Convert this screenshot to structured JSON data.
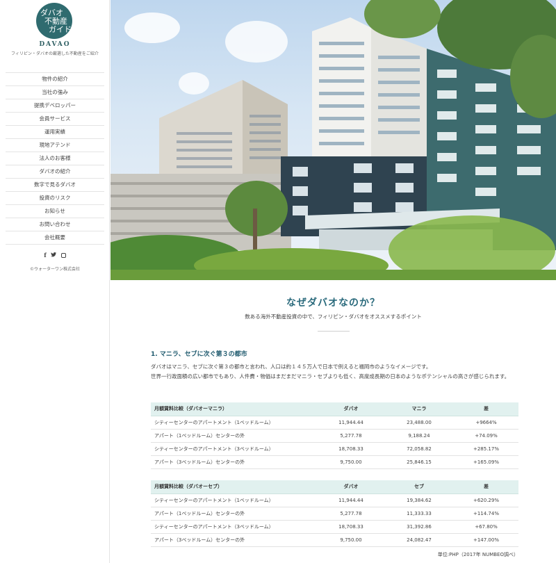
{
  "logo": {
    "mark_line1": "ダバオ",
    "mark_line2": "不動産",
    "mark_line3": "ガイド",
    "wordmark": "DAVAO",
    "tagline": "フィリピン・ダバオの厳選した不動産をご紹介"
  },
  "nav": {
    "items": [
      {
        "label": "物件の紹介"
      },
      {
        "label": "当社の強み"
      },
      {
        "label": "提携デベロッパー"
      },
      {
        "label": "会員サービス"
      },
      {
        "label": "運用実績"
      },
      {
        "label": "現地アテンド"
      },
      {
        "label": "法人のお客様"
      },
      {
        "label": "ダバオの紹介"
      },
      {
        "label": "数字で見るダバオ"
      },
      {
        "label": "投資のリスク"
      },
      {
        "label": "お知らせ"
      },
      {
        "label": "お問い合わせ"
      },
      {
        "label": "会社概要"
      }
    ]
  },
  "social": {
    "facebook": "f",
    "twitter": "🐦",
    "icons": [
      "facebook-icon",
      "twitter-icon",
      "instagram-icon"
    ]
  },
  "footer": {
    "copyright": "©ウォーターワン株式会社"
  },
  "main": {
    "title": "なぜダバオなのか？",
    "subtitle": "数ある海外不動産投資の中で、フィリピン・ダバオをオススメするポイント",
    "section1": {
      "title": "1. マニラ、セブに次ぐ第３の都市",
      "para1": "ダバオはマニラ、セブに次ぐ第３の都市と言われ、人口は約１４５万人で日本で例えると福岡市のようなイメージです。",
      "para2": "世界一行政面積の広い都市でもあり、人件費・物価はまだまだマニラ・セブよりも低く、高度成長期の日本のようなポテンシャルの高さが感じられます。"
    },
    "table1": {
      "headers": [
        "月額賃料比較（ダバオーマニラ）",
        "ダバオ",
        "マニラ",
        "差"
      ],
      "rows": [
        [
          "シティーセンターのアパートメント（1ベッドルーム）",
          "11,944.44",
          "23,488.00",
          "+9664%"
        ],
        [
          "アパート（1ベッドルーム）センターの外",
          "5,277.78",
          "9,188.24",
          "+74.09%"
        ],
        [
          "シティーセンターのアパートメント（3ベッドルーム）",
          "18,708.33",
          "72,058.82",
          "+285.17%"
        ],
        [
          "アパート（3ベッドルーム）センターの外",
          "9,750.00",
          "25,846.15",
          "+165.09%"
        ]
      ]
    },
    "table2": {
      "headers": [
        "月額賃料比較（ダバオーセブ）",
        "ダバオ",
        "セブ",
        "差"
      ],
      "rows": [
        [
          "シティーセンターのアパートメント（1ベッドルーム）",
          "11,944.44",
          "19,384.62",
          "+620.29%"
        ],
        [
          "アパート（1ベッドルーム）センターの外",
          "5,277.78",
          "11,333.33",
          "+114.74%"
        ],
        [
          "シティーセンターのアパートメント（3ベッドルーム）",
          "18,708.33",
          "31,392.86",
          "+67.80%"
        ],
        [
          "アパート（3ベッドルーム）センターの外",
          "9,750.00",
          "24,082.47",
          "+147.00%"
        ]
      ]
    },
    "unit_note": "単位:PHP（2017年 NUMBEO調べ）"
  },
  "colors": {
    "accent": "#2a6a7c",
    "logo_bg": "#2f6b6f",
    "table_header_bg": "#e1f1ef"
  }
}
